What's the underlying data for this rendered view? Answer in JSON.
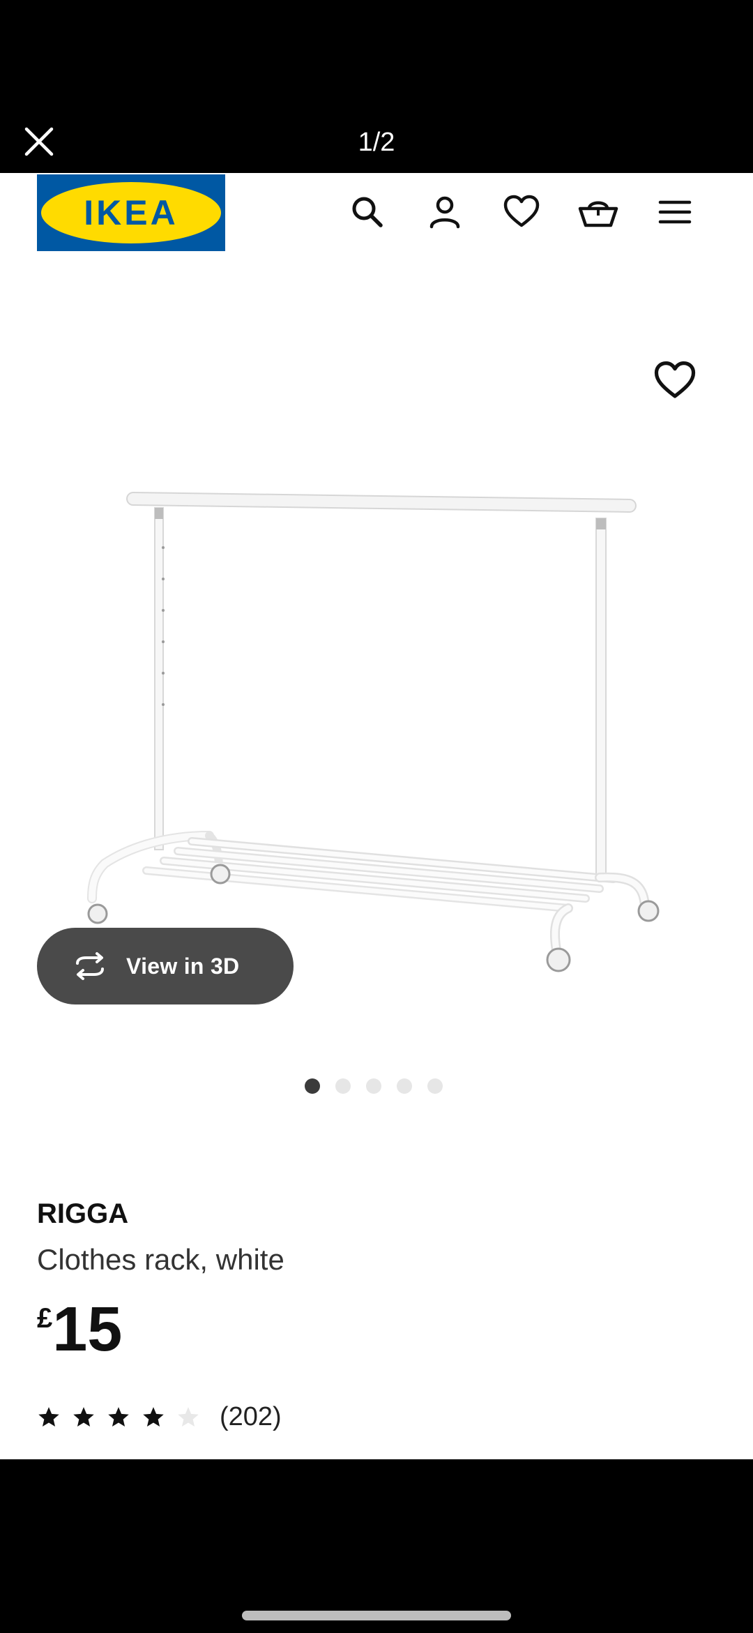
{
  "viewer": {
    "page_counter": "1/2",
    "close_icon": "close-icon"
  },
  "header": {
    "brand": "IKEA",
    "brand_colors": {
      "blue": "#0058A3",
      "yellow": "#FFDB00"
    },
    "icons": [
      "search-icon",
      "account-icon",
      "heart-icon",
      "basket-icon",
      "menu-icon"
    ]
  },
  "gallery": {
    "favourite_icon": "heart-icon",
    "view_3d_label": "View in 3D",
    "view_3d_icon": "rotate-icon",
    "dot_count": 5,
    "active_dot": 1
  },
  "product": {
    "name": "RIGGA",
    "description": "Clothes rack, white",
    "currency": "£",
    "price": "15",
    "rating_value": 4,
    "rating_max": 5,
    "review_count": "(202)"
  },
  "colors": {
    "text": "#111111",
    "pill_bg": "#4a4a4a",
    "dot_active": "#3b3b3b",
    "dot_inactive": "#e6e6e6"
  }
}
